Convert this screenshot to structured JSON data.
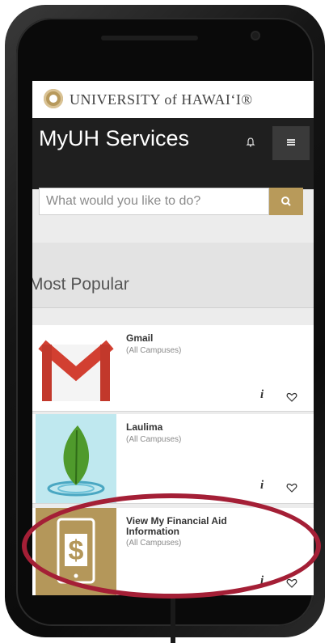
{
  "brand": {
    "university_name": "UNIVERSITY of HAWAIʻI®",
    "accent_color": "#b89a5a",
    "highlight_color": "#a41f36"
  },
  "header": {
    "title": "MyUH Services",
    "bell_icon": "bell-icon",
    "menu_icon": "hamburger-menu-icon"
  },
  "search": {
    "placeholder": "What would you like to do?",
    "icon": "search-icon"
  },
  "section": {
    "title": "Most Popular"
  },
  "services": [
    {
      "name": "Gmail",
      "scope": "(All Campuses)",
      "icon": "gmail-icon"
    },
    {
      "name": "Laulima",
      "scope": "(All Campuses)",
      "icon": "laulima-leaf-icon"
    },
    {
      "name": "View My Financial Aid Information",
      "scope": "(All Campuses)",
      "icon": "financial-aid-dollar-icon"
    }
  ]
}
